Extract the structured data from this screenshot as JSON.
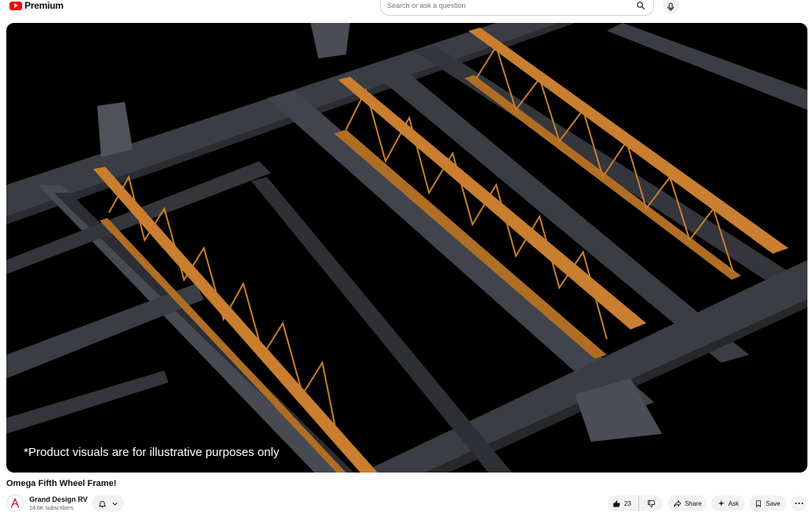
{
  "header": {
    "logo_text": "Premium",
    "search_placeholder": "Search or ask a question",
    "icons": {
      "logo": "youtube-logo-icon",
      "search": "search-icon",
      "mic": "microphone-icon"
    }
  },
  "video": {
    "caption": "*Product visuals are for illustrative purposes only"
  },
  "meta": {
    "title": "Omega Fifth Wheel Frame!",
    "channel_name": "Grand Design RV",
    "subscribers": "14.6K subscribers"
  },
  "actions": {
    "like_count": "23",
    "share_label": "Share",
    "ask_label": "Ask",
    "save_label": "Save"
  },
  "colors": {
    "brand_red": "#ff0000",
    "frame_gray": "#3a3d44",
    "joist_orange": "#c97f2f"
  }
}
